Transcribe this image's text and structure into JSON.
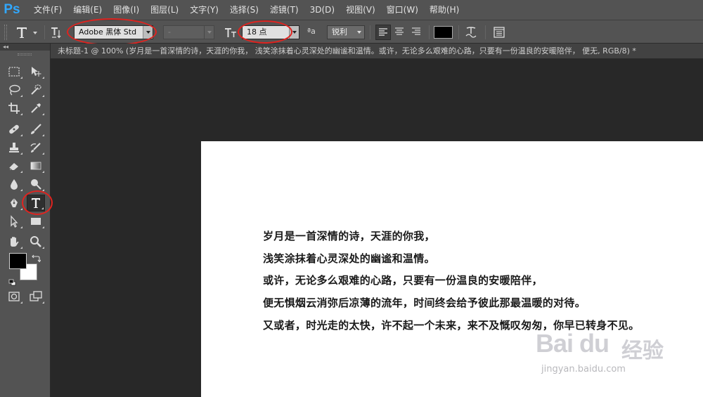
{
  "app": {
    "logo": "Ps"
  },
  "menu": [
    {
      "label": "文件(F)"
    },
    {
      "label": "编辑(E)"
    },
    {
      "label": "图像(I)"
    },
    {
      "label": "图层(L)"
    },
    {
      "label": "文字(Y)"
    },
    {
      "label": "选择(S)"
    },
    {
      "label": "滤镜(T)"
    },
    {
      "label": "3D(D)"
    },
    {
      "label": "视图(V)"
    },
    {
      "label": "窗口(W)"
    },
    {
      "label": "帮助(H)"
    }
  ],
  "options_bar": {
    "font_family": "Adobe 黑体 Std",
    "font_style": "-",
    "font_size": "18 点",
    "aa_icon_text": "ªa",
    "antialias": "锐利",
    "color_hex": "#000000"
  },
  "document": {
    "tab_title": "未标题-1 @ 100% (岁月是一首深情的诗，天涯的你我，  浅笑涂抹着心灵深处的幽谧和温情。或许，无论多么艰难的心路，只要有一份温良的安暖陪伴，  便无, RGB/8) *",
    "lines": [
      "岁月是一首深情的诗，天涯的你我，",
      "浅笑涂抹着心灵深处的幽谧和温情。",
      "或许，无论多么艰难的心路，只要有一份温良的安暖陪伴，",
      "便无惧烟云消弥后凉薄的流年，时间终会给予彼此那最温暖的对待。",
      "又或者，时光走的太快，许不起一个未来，来不及慨叹匆匆，你早已转身不见。"
    ]
  },
  "toolbar": {
    "collapse_label": "◂◂",
    "foreground_color": "#000000",
    "background_color": "#ffffff"
  },
  "watermark": {
    "logo": "Bai du",
    "cn": "经验",
    "url": "jingyan.baidu.com"
  },
  "annotation_color": "#e0231f"
}
